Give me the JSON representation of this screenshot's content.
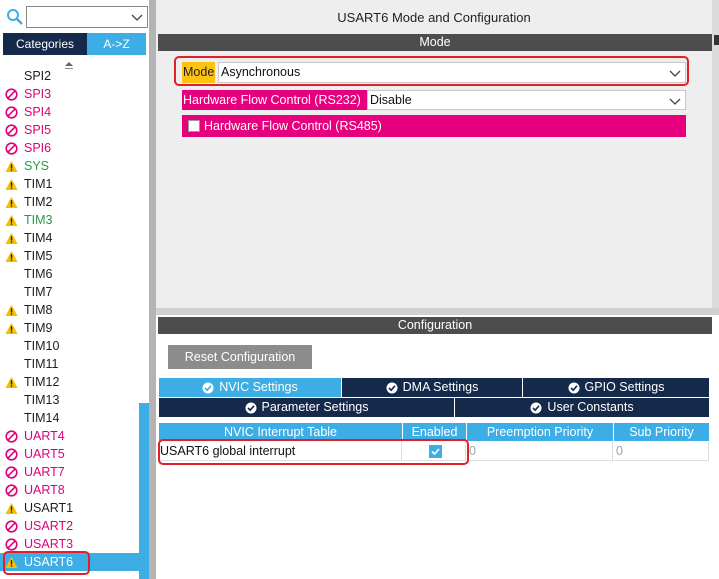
{
  "left": {
    "tabs": {
      "categories": "Categories",
      "az": "A->Z"
    },
    "items": [
      {
        "label": "SPI2",
        "status": "none",
        "color": "dark"
      },
      {
        "label": "SPI3",
        "status": "disabled",
        "color": "pink"
      },
      {
        "label": "SPI4",
        "status": "disabled",
        "color": "pink"
      },
      {
        "label": "SPI5",
        "status": "disabled",
        "color": "pink"
      },
      {
        "label": "SPI6",
        "status": "disabled",
        "color": "pink"
      },
      {
        "label": "SYS",
        "status": "warning",
        "color": "green"
      },
      {
        "label": "TIM1",
        "status": "warning",
        "color": "dark"
      },
      {
        "label": "TIM2",
        "status": "warning",
        "color": "dark"
      },
      {
        "label": "TIM3",
        "status": "warning",
        "color": "green"
      },
      {
        "label": "TIM4",
        "status": "warning",
        "color": "dark"
      },
      {
        "label": "TIM5",
        "status": "warning",
        "color": "dark"
      },
      {
        "label": "TIM6",
        "status": "none",
        "color": "dark"
      },
      {
        "label": "TIM7",
        "status": "none",
        "color": "dark"
      },
      {
        "label": "TIM8",
        "status": "warning",
        "color": "dark"
      },
      {
        "label": "TIM9",
        "status": "warning",
        "color": "dark"
      },
      {
        "label": "TIM10",
        "status": "none",
        "color": "dark"
      },
      {
        "label": "TIM11",
        "status": "none",
        "color": "dark"
      },
      {
        "label": "TIM12",
        "status": "warning",
        "color": "dark"
      },
      {
        "label": "TIM13",
        "status": "none",
        "color": "dark"
      },
      {
        "label": "TIM14",
        "status": "none",
        "color": "dark"
      },
      {
        "label": "UART4",
        "status": "disabled",
        "color": "pink"
      },
      {
        "label": "UART5",
        "status": "disabled",
        "color": "pink"
      },
      {
        "label": "UART7",
        "status": "disabled",
        "color": "pink"
      },
      {
        "label": "UART8",
        "status": "disabled",
        "color": "pink"
      },
      {
        "label": "USART1",
        "status": "warning",
        "color": "dark"
      },
      {
        "label": "USART2",
        "status": "disabled",
        "color": "pink"
      },
      {
        "label": "USART3",
        "status": "disabled",
        "color": "pink"
      },
      {
        "label": "USART6",
        "status": "warning",
        "color": "selected"
      }
    ]
  },
  "top_panel": {
    "title": "USART6 Mode and Configuration",
    "section": "Mode",
    "mode_label": "Mode",
    "mode_value": "Asynchronous",
    "hfc232_label": "Hardware Flow Control (RS232)",
    "hfc232_value": "Disable",
    "hfc485_label": "Hardware Flow Control (RS485)"
  },
  "bottom_panel": {
    "section": "Configuration",
    "reset_button": "Reset Configuration",
    "tabs_row1": [
      "NVIC Settings",
      "DMA Settings",
      "GPIO Settings"
    ],
    "tabs_row2": [
      "Parameter Settings",
      "User Constants"
    ],
    "table_headers": [
      "NVIC Interrupt Table",
      "Enabled",
      "Preemption Priority",
      "Sub Priority"
    ],
    "row": {
      "name": "USART6 global interrupt",
      "enabled": true,
      "preemption": "0",
      "sub": "0"
    }
  },
  "colors": {
    "accent": "#3daee5",
    "navy": "#15294b",
    "pink": "#e6007e",
    "mode_yellow": "#ffc20e",
    "highlight_red": "#e0202a"
  }
}
